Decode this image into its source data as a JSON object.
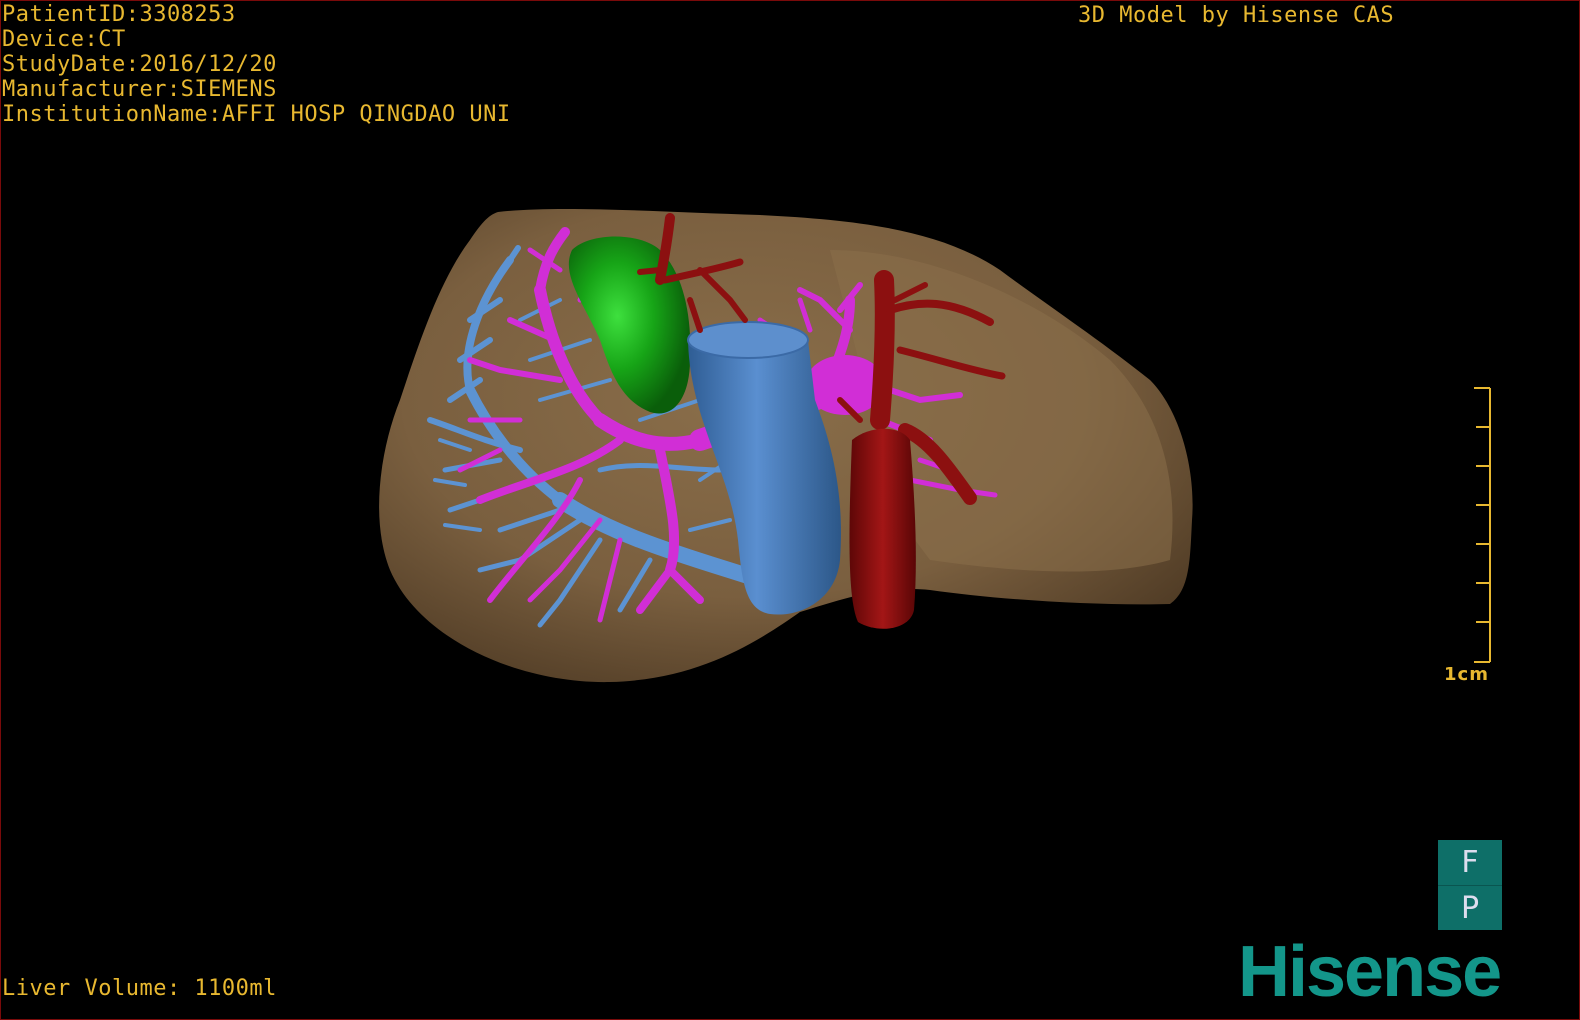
{
  "header": {
    "patient_id": "PatientID:3308253",
    "device": "Device:CT",
    "study_date": "StudyDate:2016/12/20",
    "manufacturer": "Manufacturer:SIEMENS",
    "institution": "InstitutionName:AFFI HOSP QINGDAO UNI"
  },
  "credit": "3D Model by Hisense CAS",
  "footer": {
    "liver_volume": "Liver Volume: 1100ml"
  },
  "scale_bar": {
    "label": "1cm"
  },
  "orientation": {
    "top": "F",
    "bottom": "P"
  },
  "brand": {
    "name": "Hisense"
  },
  "colors": {
    "liver": "#7a6040",
    "gallbladder": "#16b016",
    "portal_vein": "#d12ed6",
    "hepatic_vein": "#5c93d2",
    "ivc": "#4a80bf",
    "artery": "#8c1010",
    "overlay_text": "#e8b830",
    "brand": "#13968a"
  }
}
